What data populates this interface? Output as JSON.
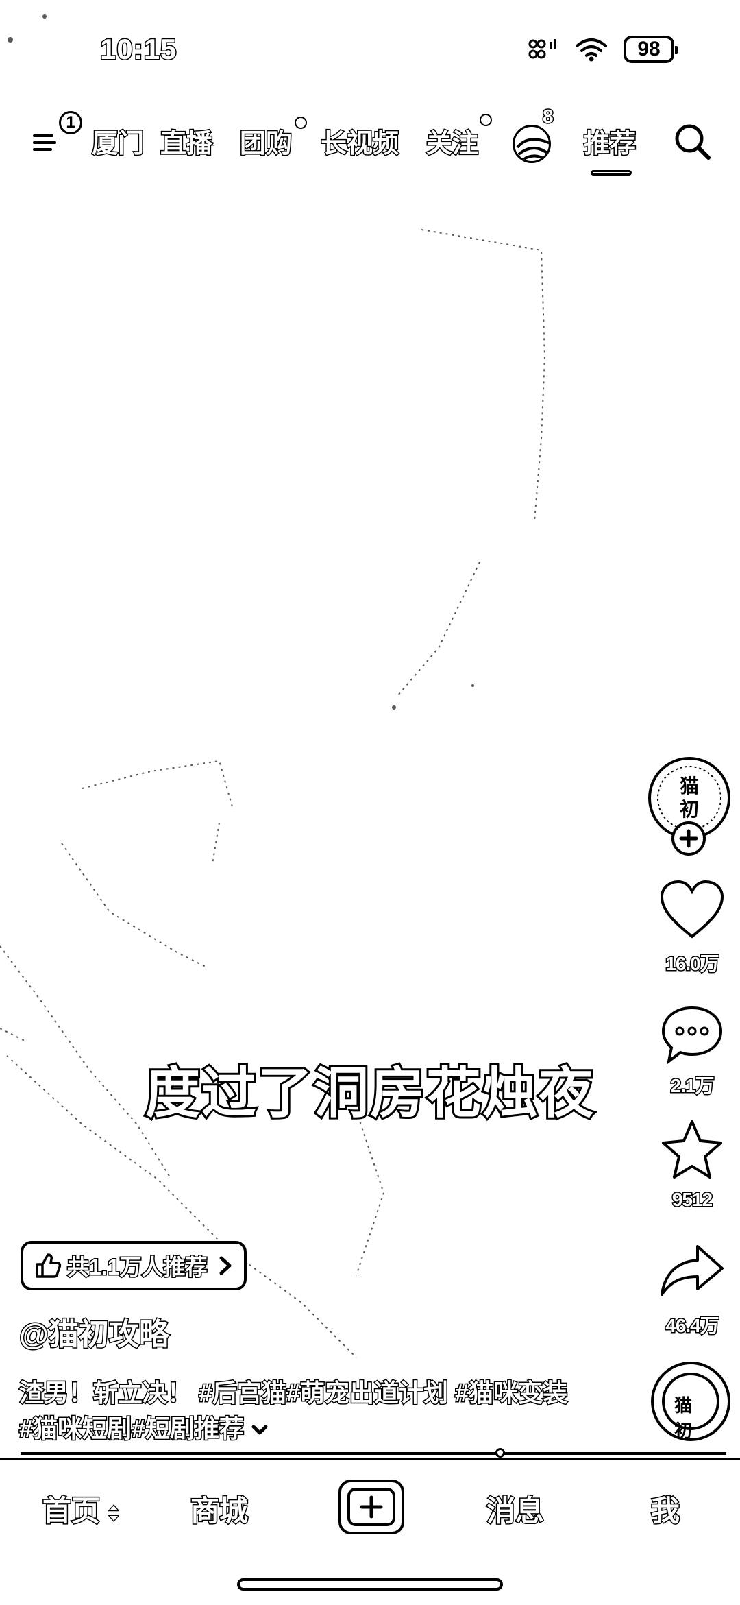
{
  "status_bar": {
    "time": "10:15",
    "battery": "98",
    "icons": [
      "grid-signal-icon",
      "wifi-icon",
      "battery-icon"
    ]
  },
  "top_nav": {
    "menu_badge": "1",
    "tabs": [
      {
        "label": "厦门"
      },
      {
        "label": "直播"
      },
      {
        "label": "团购"
      },
      {
        "label": "长视频"
      },
      {
        "label": "关注"
      },
      {
        "label": "推荐",
        "active": true
      }
    ],
    "avatar_badge": "8",
    "search_icon": "search-icon"
  },
  "video": {
    "subtitle": "度过了洞房花烛夜"
  },
  "side_rail": {
    "author_avatar_text": "猫初",
    "likes": "16.0万",
    "comments": "2.1万",
    "favorites": "9512",
    "shares": "46.4万",
    "music_disc_text": "猫初"
  },
  "recommend": {
    "text": "共1.1万人推荐"
  },
  "post": {
    "author": "@猫初攻略",
    "caption": "渣男！斩立决！ #后宫猫#萌宠出道计划 #猫咪变装 #猫咪短剧#短剧推荐"
  },
  "bottom_tabs": {
    "home": "首页",
    "mall": "商城",
    "messages": "消息",
    "me": "我"
  },
  "playback": {
    "progress_fraction": 0.68
  }
}
